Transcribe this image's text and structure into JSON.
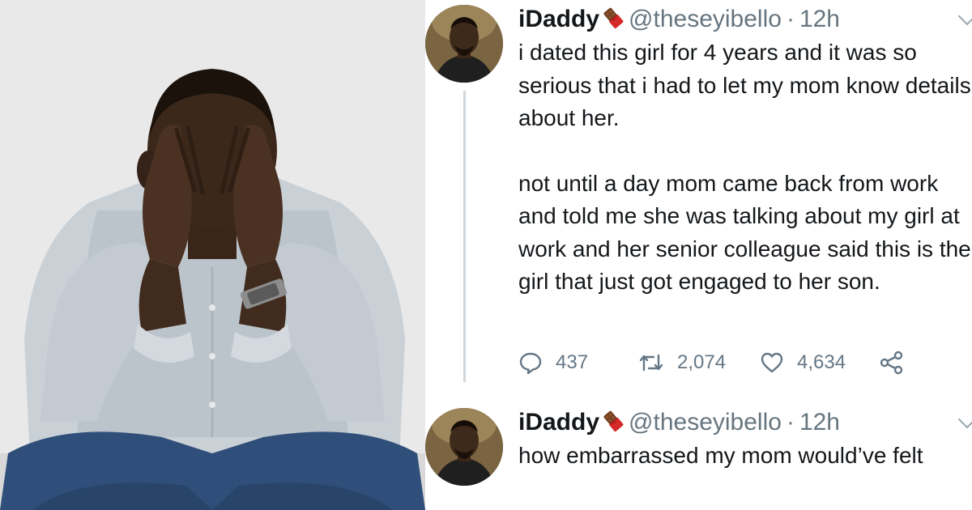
{
  "tweets": [
    {
      "display_name": "iDaddy",
      "badge_icon": "chocolate-bar-icon",
      "handle": "@theseyibello",
      "separator": "·",
      "time": "12h",
      "paragraphs": [
        "i dated this girl for 4 years and it was so serious that i had to let my mom know details about her.",
        "not until a day mom came back from work and told me she was talking about my girl at work and her senior colleague said this is the girl that just got engaged to her son."
      ],
      "actions": {
        "replies": "437",
        "retweets": "2,074",
        "likes": "4,634"
      }
    },
    {
      "display_name": "iDaddy",
      "badge_icon": "chocolate-bar-icon",
      "handle": "@theseyibello",
      "separator": "·",
      "time": "12h",
      "text": "how embarrassed my mom would’ve felt"
    }
  ],
  "colors": {
    "text_primary": "#14171a",
    "text_secondary": "#66757f",
    "thread_line": "#d0d7dd",
    "badge_chocolate": "#6b3a1f",
    "badge_wrapper": "#d62a2a"
  }
}
